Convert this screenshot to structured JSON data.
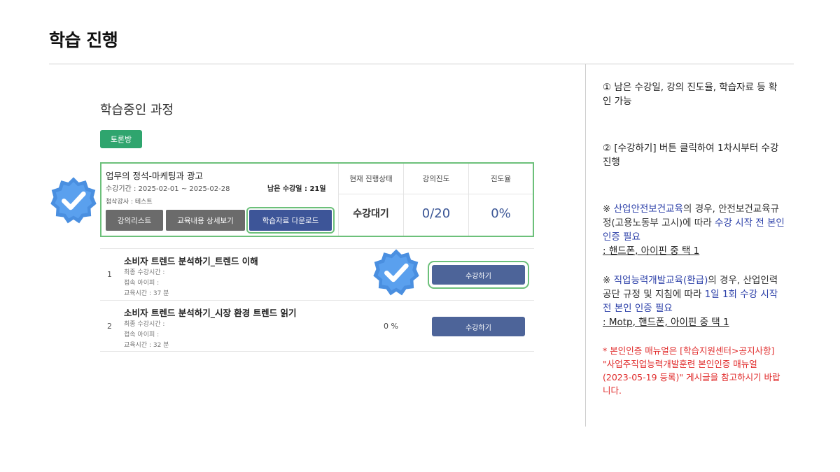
{
  "page": {
    "title": "학습 진행"
  },
  "section": {
    "title": "학습중인 과정",
    "discussion_button": "토론방"
  },
  "course": {
    "name": "업무의 정석-마케팅과 광고",
    "period": "수강기간 : 2025-02-01 ~ 2025-02-28",
    "teacher": "첨삭강사 : 테스트",
    "remaining": "남은 수강일 : 21일",
    "buttons": {
      "list": "강의리스트",
      "detail": "교육내용 상세보기",
      "download": "학습자료 다운로드"
    },
    "headers": {
      "status": "현재 진행상태",
      "progress": "강의진도",
      "rate": "진도율"
    },
    "values": {
      "status": "수강대기",
      "progress": "0/20",
      "rate": "0%"
    }
  },
  "lessons": [
    {
      "num": "1",
      "title": "소비자 트렌드 분석하기_트렌드 이해",
      "last_time": "최종 수강시간 :",
      "ip": "접속 아이피 :",
      "edu_time": "교육시간 : 37 분",
      "progress": "",
      "button": "수강하기"
    },
    {
      "num": "2",
      "title": "소비자 트렌드 분석하기_시장 환경 트렌드 읽기",
      "last_time": "최종 수강시간 :",
      "ip": "접속 아이피 :",
      "edu_time": "교육시간 : 32 분",
      "progress": "0 %",
      "button": "수강하기"
    }
  ],
  "notes": {
    "n1": "① 남은 수강일, 강의 진도율, 학습자료 등 확인 가능",
    "n2": "② [수강하기] 버튼 클릭하여 1차시부터 수강 진행",
    "n3": {
      "a": "※ ",
      "b": "산업안전보건교육",
      "c": "의 경우, 안전보건교육규정(고용노동부 고시)에 따라 ",
      "d": "수강 시작 전 본인 인증 필요",
      "e": " : 핸드폰, 아이핀 중 택 1"
    },
    "n4": {
      "a": "※ ",
      "b": "직업능력개발교육(환급)",
      "c": "의 경우, 산업인력공단 규정 및 지침에 따라 ",
      "d": "1일 1회 수강 시작 전 본인 인증 필요",
      "e": " : Motp, 핸드폰, 아이핀 중 택 1"
    },
    "n5": "* 본인인증 매뉴얼은 [학습지원센터>공지사항] \"사업주직업능력개발훈련 본인인증 매뉴얼(2023-05-19 등록)\" 게시글을 참고하시기 바랍니다."
  },
  "colors": {
    "accent_green": "#6cc07a",
    "button_blue": "#3d5598",
    "badge_blue": "#4a8fe0",
    "warning_red": "#e02a2a"
  }
}
